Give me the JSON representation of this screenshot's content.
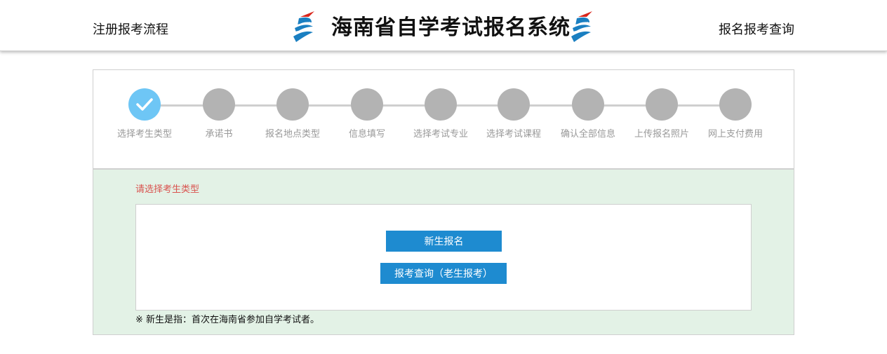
{
  "header": {
    "left_link": "注册报考流程",
    "title": "海南省自学考试报名系统",
    "right_link": "报名报考查询",
    "logo_icon": "hainan-exam-logo-icon",
    "colors": {
      "logo_red": "#d9261c",
      "logo_blue": "#1a7fc1"
    }
  },
  "steps": [
    {
      "label": "选择考生类型",
      "state": "active"
    },
    {
      "label": "承诺书",
      "state": "pending"
    },
    {
      "label": "报名地点类型",
      "state": "pending"
    },
    {
      "label": "信息填写",
      "state": "pending"
    },
    {
      "label": "选择考试专业",
      "state": "pending"
    },
    {
      "label": "选择考试课程",
      "state": "pending"
    },
    {
      "label": "确认全部信息",
      "state": "pending"
    },
    {
      "label": "上传报名照片",
      "state": "pending"
    },
    {
      "label": "网上支付费用",
      "state": "pending"
    }
  ],
  "main": {
    "prompt": "请选择考生类型",
    "new_button": "新生报名",
    "query_button": "报考查询（老生报考）",
    "note": "※ 新生是指：首次在海南省参加自学考试者。"
  },
  "colors": {
    "active_step": "#6ec6f5",
    "pending_step": "#b3b3b3",
    "button": "#1e8bd0",
    "prompt": "#d9534f",
    "content_bg": "#e3f2e6"
  }
}
